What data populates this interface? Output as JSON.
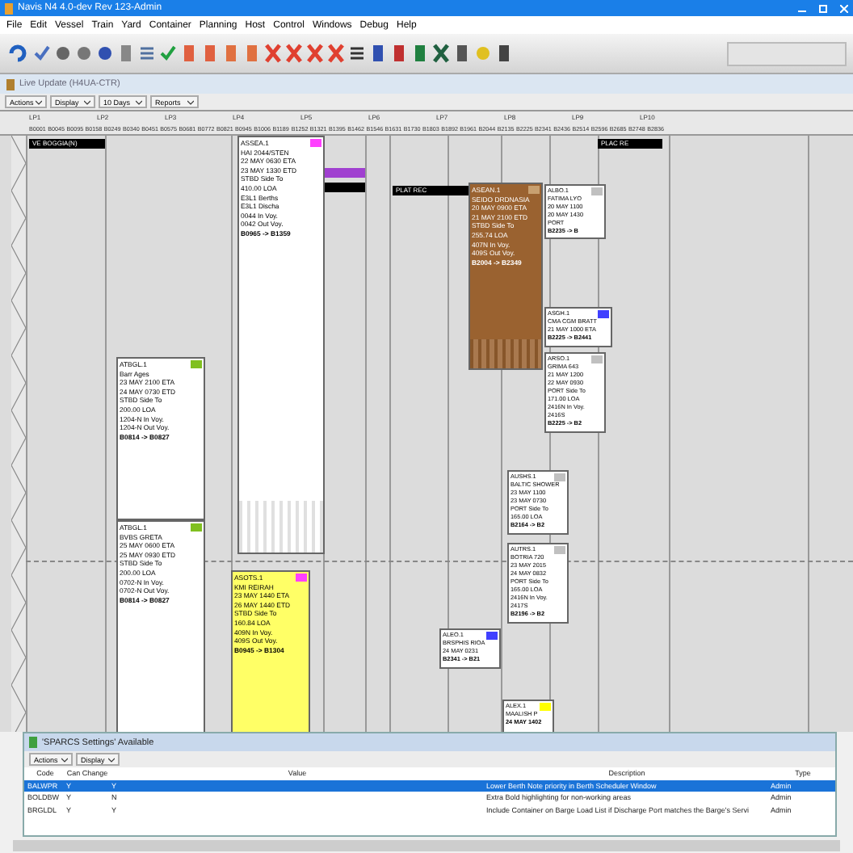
{
  "window": {
    "title": "Navis N4 4.0-dev Rev 123-Admin"
  },
  "menu": [
    "File",
    "Edit",
    "Vessel",
    "Train",
    "Yard",
    "Container",
    "Planning",
    "Host",
    "Control",
    "Windows",
    "Debug",
    "Help"
  ],
  "berth_window": {
    "title": "Live Update (H4UA-CTR)",
    "filters": [
      "Actions",
      "Display",
      "10 Days",
      "Reports"
    ],
    "sections": [
      "LP1",
      "LP2",
      "LP3",
      "LP4",
      "LP5",
      "LP6",
      "LP7",
      "LP8",
      "LP9",
      "LP10"
    ],
    "positions": [
      "B0001",
      "B0045",
      "B0095",
      "B0158",
      "B0249",
      "B0340",
      "B0451",
      "B0575",
      "B0681",
      "B0772",
      "B0821",
      "B0945",
      "B1006",
      "B1189",
      "B1252",
      "B1321",
      "B1395",
      "B1462",
      "B1546",
      "B1631",
      "B1730",
      "B1803",
      "B1892",
      "B1961",
      "B2044",
      "B2135",
      "B2225",
      "B2341",
      "B2436",
      "B2514",
      "B2596",
      "B2685",
      "B2748",
      "B2836"
    ],
    "labels": [
      "VE BOGGIA(N)",
      "PLAT REC",
      "PLAC RE"
    ],
    "bars": [
      {
        "color": "#a040d0"
      },
      {
        "color": "#000000"
      }
    ],
    "vessels": [
      {
        "color": "#ffffff",
        "badge": {
          "color": "#ff40ff"
        },
        "lines": [
          "ASSEA.1",
          "HAI 2044/STEN",
          "22 MAY 0630 ETA",
          "23 MAY 1330 ETD",
          "STBD Side To",
          "410.00 LOA",
          "E3L1 Berths",
          "E3L1 Discha",
          "0044 In Voy.",
          "0042 Out Voy.",
          "B0965 -> B1359"
        ]
      },
      {
        "color": "#9a6230",
        "badge": {
          "color": "#c8a070"
        },
        "lines": [
          "ASEAN.1",
          "SEIDO DRDNASIA",
          "20 MAY 0900 ETA",
          "21 MAY 2100 ETD",
          "STBD Side To",
          "255.74 LOA",
          "407N In Voy.",
          "409S Out Voy.",
          "B2004 -> B2349"
        ]
      },
      {
        "color": "#ffffff",
        "badge": {
          "color": "#c0c0c0"
        },
        "lines": [
          "ALBO.1",
          "FATIMA LYO",
          "20 MAY 1100",
          "20 MAY 1430",
          "PORT",
          "B2235 -> B"
        ]
      },
      {
        "color": "#ffffff",
        "badge": {
          "color": "#4040ff"
        },
        "lines": [
          "ASGH.1",
          "CMA CGM BRATT",
          "21 MAY 1000 ETA",
          "B2225 -> B2441"
        ]
      },
      {
        "color": "#ffffff",
        "badge": {
          "color": "#c0c0c0"
        },
        "lines": [
          "ARSO.1",
          "GRIMA 643",
          "21 MAY 1200",
          "22 MAY 0930",
          "PORT Side To",
          "171.00 LOA",
          "2416N In Voy.",
          "2416S",
          "B2225 -> B2"
        ]
      },
      {
        "color": "#ffffff",
        "badge": {
          "color": "#c0c0c0"
        },
        "lines": [
          "AUSHS.1",
          "BALTIC SHOWER",
          "23 MAY 1100",
          "23 MAY 0730",
          "PORT Side To",
          "165.00 LOA",
          "B2164 -> B2"
        ]
      },
      {
        "color": "#ffffff",
        "badge": {
          "color": "#c0c0c0"
        },
        "lines": [
          "AUTRS.1",
          "BOTRIA 720",
          "23 MAY 2015",
          "24 MAY 0832",
          "PORT Side To",
          "165.00 LOA",
          "2416N In Voy.",
          "2417S",
          "B2196 -> B2"
        ]
      },
      {
        "color": "#ffffff",
        "badge": {
          "color": "#80c020"
        },
        "lines": [
          "ATBGL.1",
          "Barr Ages",
          "23 MAY 2100 ETA",
          "24 MAY 0730 ETD",
          "STBD Side To",
          "200.00 LOA",
          "1204-N In Voy.",
          "1204-N Out Voy.",
          "B0814 -> B0827"
        ]
      },
      {
        "color": "#ffffff",
        "badge": {
          "color": "#80c020"
        },
        "lines": [
          "ATBGL.1",
          "BVBS GRETA",
          "25 MAY 0600 ETA",
          "25 MAY 0930 ETD",
          "STBD Side To",
          "200.00 LOA",
          "0702-N In Voy.",
          "0702-N Out Voy.",
          "B0814 -> B0827"
        ]
      },
      {
        "color": "#ffff66",
        "badge": {
          "color": "#ff40ff"
        },
        "lines": [
          "ASOTS.1",
          "KMI REIRAH",
          "23 MAY 1440 ETA",
          "26 MAY 1440 ETD",
          "STBD Side To",
          "160.84 LOA",
          "409N In Voy.",
          "409S Out Voy.",
          "B0945 -> B1304"
        ]
      },
      {
        "color": "#ffffff",
        "badge": {
          "color": "#4040ff"
        },
        "lines": [
          "ALEO.1",
          "BRSPHIS RIOA",
          "24 MAY 0231",
          "B2341 -> B21"
        ]
      },
      {
        "color": "#ffffff",
        "badge": {
          "color": "#ffff00"
        },
        "lines": [
          "ALEX.1",
          "MAALISH P",
          "24 MAY 1402"
        ]
      }
    ]
  },
  "settings_dialog": {
    "title": "'SPARCS Settings' Available",
    "filters": [
      "Actions",
      "Display"
    ],
    "columns": [
      "Code",
      "Can Change",
      "Value",
      "Description",
      "Type"
    ],
    "rows": [
      {
        "selected": true,
        "cells": [
          "BALWPR",
          "Y",
          "Y",
          "Lower Berth Note priority in Berth Scheduler Window",
          "Admin"
        ]
      },
      {
        "selected": false,
        "cells": [
          "BOLDBW",
          "Y",
          "N",
          "Extra Bold highlighting for non-working areas",
          "Admin"
        ]
      },
      {
        "selected": false,
        "cells": [
          "BRGLDL",
          "Y",
          "Y",
          "Include Container on Barge Load List if Discharge Port matches the Barge's Servi",
          "Admin"
        ]
      }
    ]
  }
}
